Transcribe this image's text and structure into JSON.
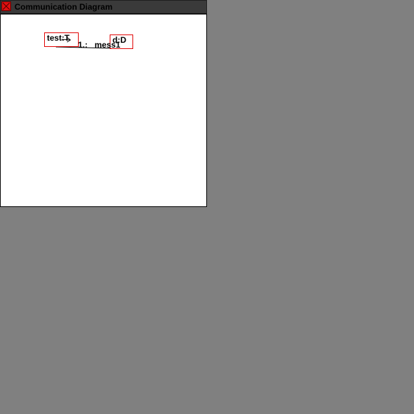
{
  "window": {
    "title": "Communication Diagram",
    "close_icon": "close-x-icon"
  },
  "diagram": {
    "nodes": [
      {
        "id": "n1",
        "label": "test:T"
      },
      {
        "id": "n2",
        "label": "d:D"
      }
    ],
    "messages": [
      {
        "from": "n1",
        "to": "n2",
        "label": "1.:   mess1"
      }
    ],
    "colors": {
      "node_border": "#e00000",
      "link": "#000000"
    }
  }
}
